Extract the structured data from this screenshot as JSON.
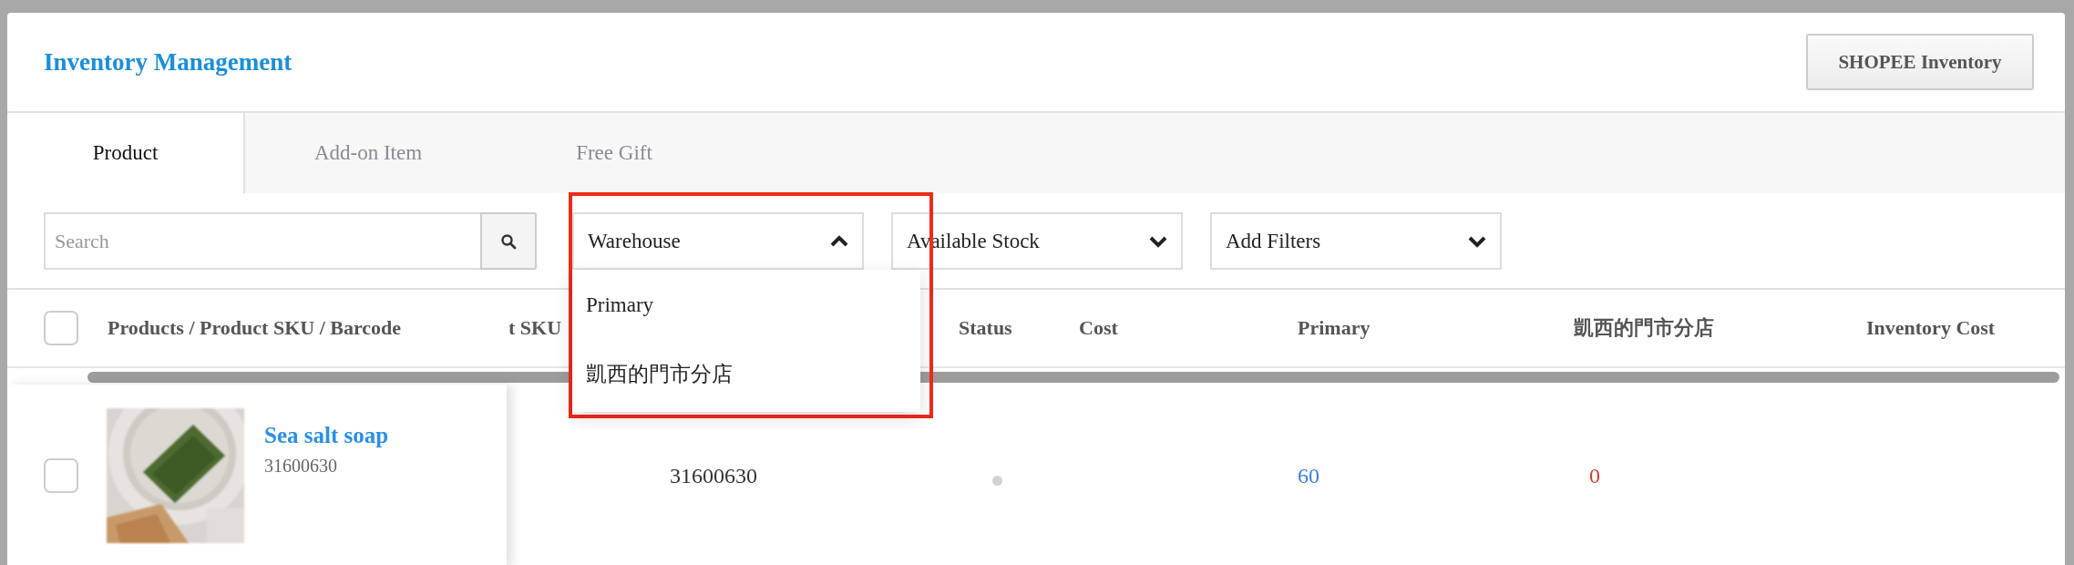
{
  "header": {
    "title": "Inventory Management",
    "button": "SHOPEE Inventory"
  },
  "tabs": [
    {
      "label": "Product",
      "selected": true
    },
    {
      "label": "Add-on Item",
      "selected": false
    },
    {
      "label": "Free Gift",
      "selected": false
    }
  ],
  "filters": {
    "search": {
      "placeholder": "Search"
    },
    "dropdowns": [
      {
        "label": "Warehouse",
        "expanded": true,
        "highlighted": true,
        "options": [
          "Primary",
          "凱西的門市分店"
        ]
      },
      {
        "label": "Available Stock",
        "expanded": false,
        "highlighted": false
      },
      {
        "label": "Add Filters",
        "expanded": false,
        "highlighted": false
      }
    ]
  },
  "table": {
    "select_all": {
      "checked": false
    },
    "columns": [
      "Products / Product SKU / Barcode",
      "t SKU",
      "Status",
      "Cost",
      "Primary",
      "凱西的門市分店",
      "Inventory Cost"
    ],
    "rows": [
      {
        "checked": false,
        "name": "Sea salt soap",
        "sku": "31600630",
        "column_2": "31600630",
        "primary": "60",
        "store": "0"
      }
    ]
  }
}
